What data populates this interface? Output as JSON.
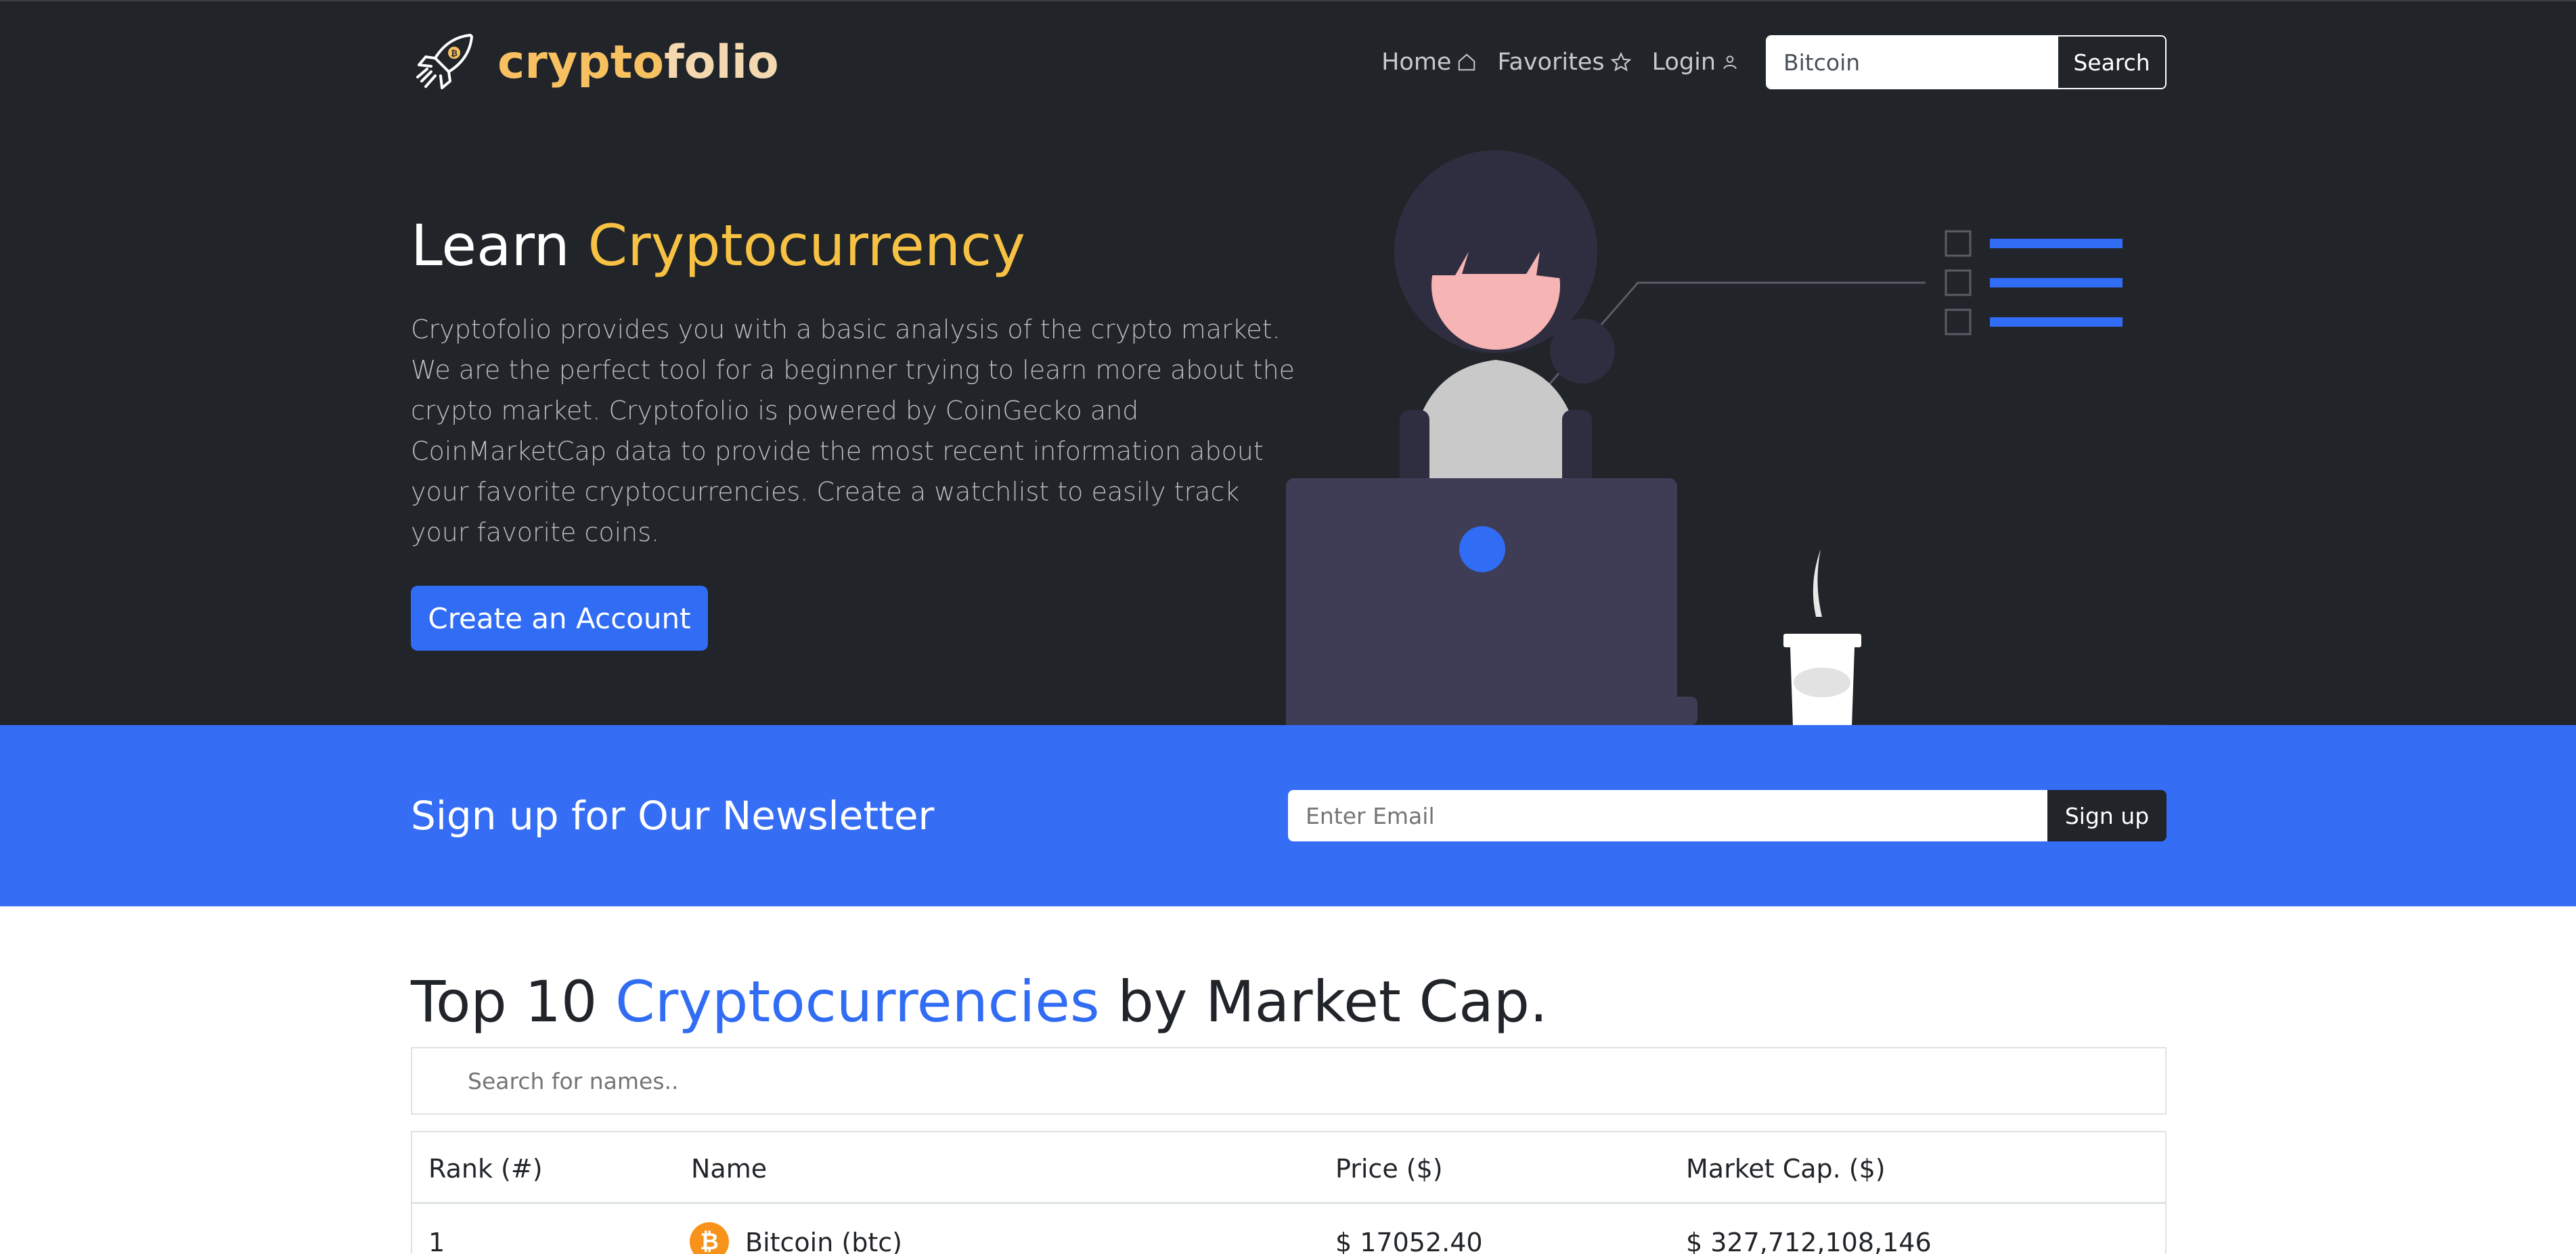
{
  "brand": {
    "part1": "crypto",
    "part2": "folio"
  },
  "nav": {
    "home": "Home",
    "favorites": "Favorites",
    "login": "Login",
    "search_value": "Bitcoin",
    "search_button": "Search"
  },
  "hero": {
    "title_plain": "Learn ",
    "title_accent": "Cryptocurrency",
    "description": "Cryptofolio provides you with a basic analysis of the crypto market. We are the perfect tool for a beginner trying to learn more about the crypto market. Cryptofolio is powered by CoinGecko and CoinMarketCap data to provide the most recent information about your favorite cryptocurrencies. Create a watchlist to easily track your favorite coins.",
    "cta": "Create an Account"
  },
  "newsletter": {
    "title": "Sign up for Our Newsletter",
    "email_placeholder": "Enter Email",
    "button": "Sign up"
  },
  "top10": {
    "title_a": "Top 10 ",
    "title_accent": "Cryptocurrencies",
    "title_b": " by Market Cap.",
    "filter_placeholder": "Search for names..",
    "headers": [
      "Rank (#)",
      "Name",
      "Price ($)",
      "Market Cap. ($)"
    ],
    "rows": [
      {
        "rank": "1",
        "name": "Bitcoin (btc)",
        "price": "$ 17052.40",
        "market_cap": "$ 327,712,108,146",
        "icon": "bitcoin-icon"
      }
    ]
  },
  "colors": {
    "hero_bg": "#212429",
    "accent_yellow": "#f7c244",
    "accent_blue": "#316cf4",
    "newsletter_bg": "#356df4"
  }
}
